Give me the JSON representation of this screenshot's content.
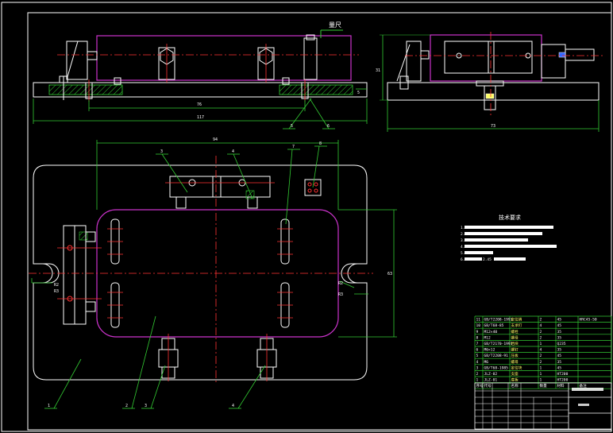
{
  "colors": {
    "background": "#000000",
    "outline": "#ffffff",
    "part": "#cc33cc",
    "centerline": "#ff3333",
    "dimension": "#33cc33",
    "leader": "#33cc33",
    "hatch": "#33cc33",
    "table": "#33cc33",
    "text_yellow": "#ffff66",
    "accent_blue": "#3366ff"
  },
  "top_view": {
    "annotation_top": "量尺",
    "dim_inner": "76",
    "dim_overall": "117",
    "dim_height_side": "5",
    "leader_labels": [
      "5",
      "6"
    ]
  },
  "side_view": {
    "dim_height": "31",
    "dim_width": "73"
  },
  "plan_view": {
    "dim_top": "94",
    "dim_right": "63",
    "dim_left_r": "R2",
    "dim_left_small": "R3",
    "dim_right_r": "R2",
    "dim_right_small": "R3",
    "leader_top_labels": [
      "3",
      "4",
      "7",
      "8"
    ],
    "leader_bottom_labels": [
      "1",
      "2",
      "3",
      "4"
    ]
  },
  "tech_req": {
    "title": "技术要求",
    "items": [
      "1.",
      "2.",
      "3.",
      "4.",
      "5.",
      "6."
    ],
    "note": "2.45"
  },
  "bom": {
    "rows": [
      {
        "no": "11",
        "code": "GB/T2208-1991",
        "name": "定位销",
        "qty": "2",
        "mat": "45",
        "note": "HRC45-50"
      },
      {
        "no": "10",
        "code": "GB/T68-85",
        "name": "支承钉",
        "qty": "4",
        "mat": "45",
        "note": ""
      },
      {
        "no": "9",
        "code": "M12×40",
        "name": "螺栓",
        "qty": "2",
        "mat": "35",
        "note": ""
      },
      {
        "no": "8",
        "code": "M12",
        "name": "螺母",
        "qty": "2",
        "mat": "35",
        "note": ""
      },
      {
        "no": "7",
        "code": "GB/T2170-1991",
        "name": "挡块",
        "qty": "1",
        "mat": "Q235",
        "note": ""
      },
      {
        "no": "6",
        "code": "M6×12",
        "name": "螺钉",
        "qty": "4",
        "mat": "35",
        "note": ""
      },
      {
        "no": "5",
        "code": "GB/T2208-91",
        "name": "压板",
        "qty": "2",
        "mat": "45",
        "note": ""
      },
      {
        "no": "4",
        "code": "M6",
        "name": "螺母",
        "qty": "2",
        "mat": "35",
        "note": ""
      },
      {
        "no": "3",
        "code": "GB/T68-1985",
        "name": "定位块",
        "qty": "1",
        "mat": "45",
        "note": ""
      },
      {
        "no": "2",
        "code": "JLZ-02",
        "name": "支座",
        "qty": "1",
        "mat": "HT200",
        "note": ""
      },
      {
        "no": "1",
        "code": "JLZ-01",
        "name": "底板",
        "qty": "1",
        "mat": "HT200",
        "note": ""
      }
    ],
    "header": [
      "序号",
      "代号",
      "名称",
      "数量",
      "材料",
      "备注"
    ]
  }
}
